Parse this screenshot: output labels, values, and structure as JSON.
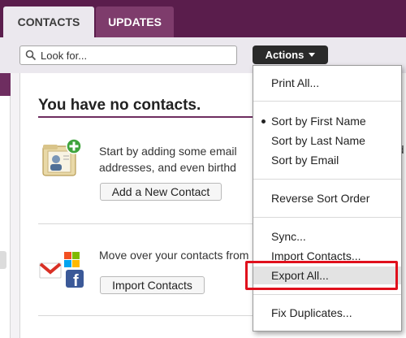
{
  "tabs": [
    {
      "label": "CONTACTS"
    },
    {
      "label": "UPDATES"
    }
  ],
  "search": {
    "placeholder": "Look for..."
  },
  "actions": {
    "label": "Actions"
  },
  "main": {
    "heading": "You have no contacts.",
    "section1": {
      "text": "Start by adding some email addresses, and even birthd",
      "button": "Add a New Contact"
    },
    "section2": {
      "text": "Move over your contacts from",
      "button": "Import Contacts"
    },
    "clipped_right": [
      "ad",
      "s",
      "s"
    ]
  },
  "menu": {
    "items": [
      {
        "label": "Print All..."
      },
      {
        "label": "Sort by First Name",
        "selected": true
      },
      {
        "label": "Sort by Last Name"
      },
      {
        "label": "Sort by Email"
      },
      {
        "label": "Reverse Sort Order"
      },
      {
        "label": "Sync..."
      },
      {
        "label": "Import Contacts..."
      },
      {
        "label": "Export All..."
      },
      {
        "label": "Fix Duplicates..."
      }
    ]
  },
  "colors": {
    "brand": "#5a1d4c",
    "highlight": "#e0101c"
  }
}
